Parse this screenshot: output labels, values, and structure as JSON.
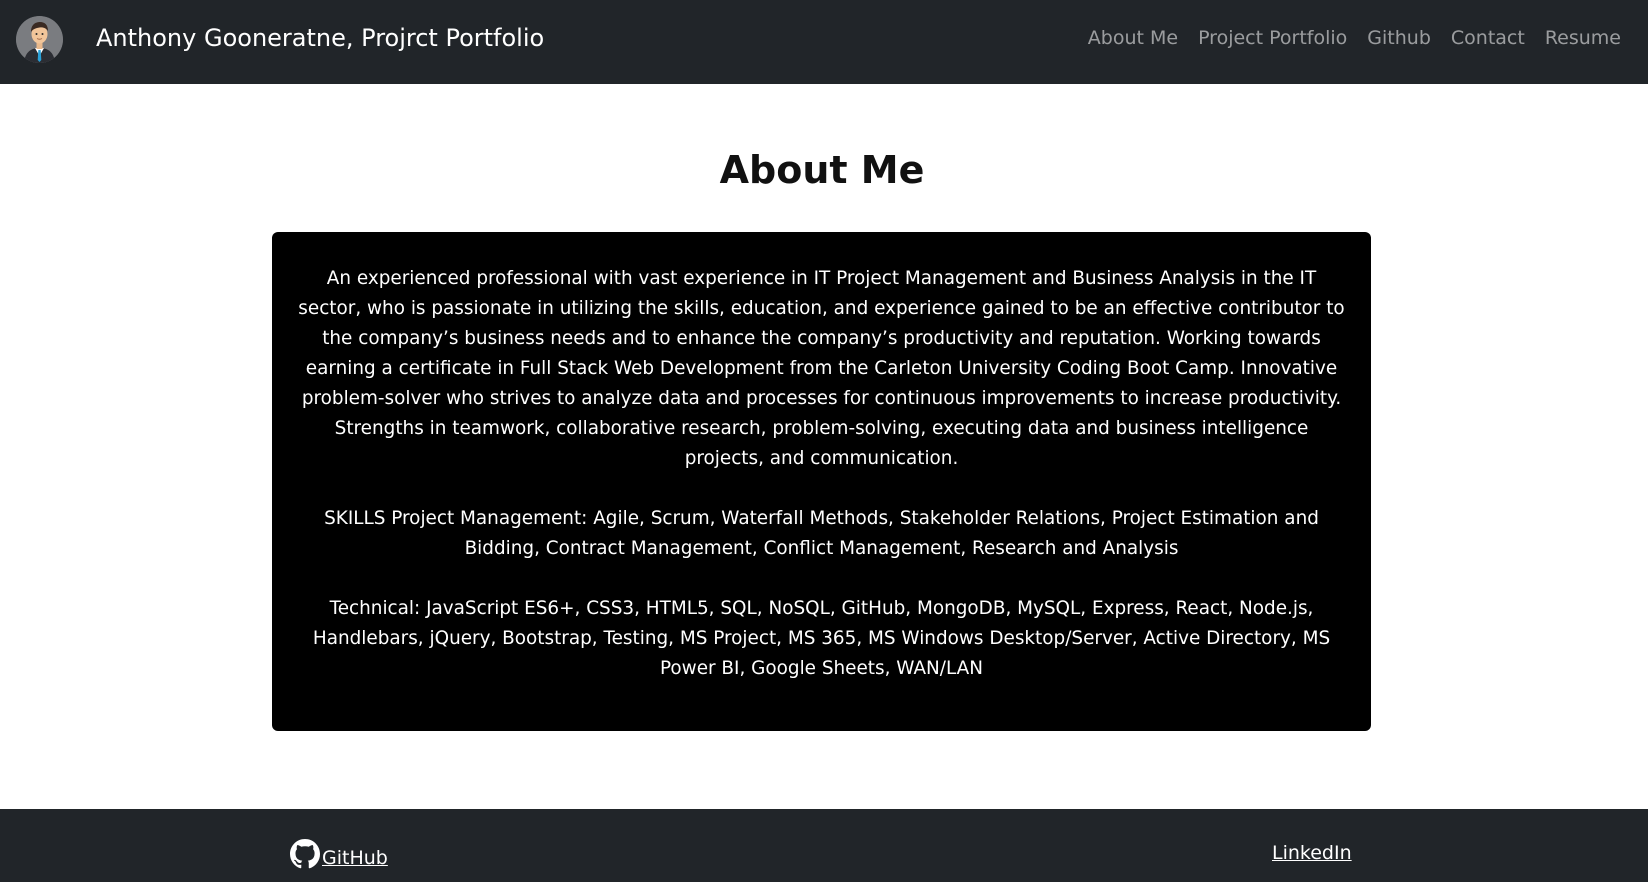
{
  "navbar": {
    "brand": "Anthony Gooneratne, Projrct Portfolio",
    "avatar_icon": "avatar-icon",
    "links": [
      {
        "label": "About Me"
      },
      {
        "label": "Project Portfolio"
      },
      {
        "label": "Github"
      },
      {
        "label": "Contact"
      },
      {
        "label": "Resume"
      }
    ],
    "link_color": "#8c8e91",
    "background": "#212529"
  },
  "main": {
    "title": "About Me",
    "card_background": "#000000",
    "paragraphs": [
      "An experienced professional with vast experience in IT Project Management and Business Analysis in the IT sector, who is passionate in utilizing the skills, education, and experience gained to be an effective contributor to the company’s business needs and to enhance the company’s productivity and reputation. Working towards earning a certificate in Full Stack Web Development from the Carleton University Coding Boot Camp. Innovative problem-solver who strives to analyze data and processes for continuous improvements to increase productivity. Strengths in teamwork, collaborative research, problem-solving, executing data and business intelligence projects, and communication.",
      "SKILLS Project Management: Agile, Scrum, Waterfall Methods, Stakeholder Relations, Project Estimation and Bidding, Contract Management, Conflict Management, Research and Analysis",
      "Technical: JavaScript ES6+, CSS3, HTML5, SQL, NoSQL, GitHub, MongoDB, MySQL, Express, React, Node.js, Handlebars, jQuery, Bootstrap, Testing, MS Project, MS 365, MS Windows Desktop/Server, Active Directory, MS Power BI, Google Sheets, WAN/LAN"
    ]
  },
  "footer": {
    "github_label": " GitHub",
    "github_icon": "github-icon",
    "linkedin_label": "LinkedIn",
    "background": "#212529"
  }
}
